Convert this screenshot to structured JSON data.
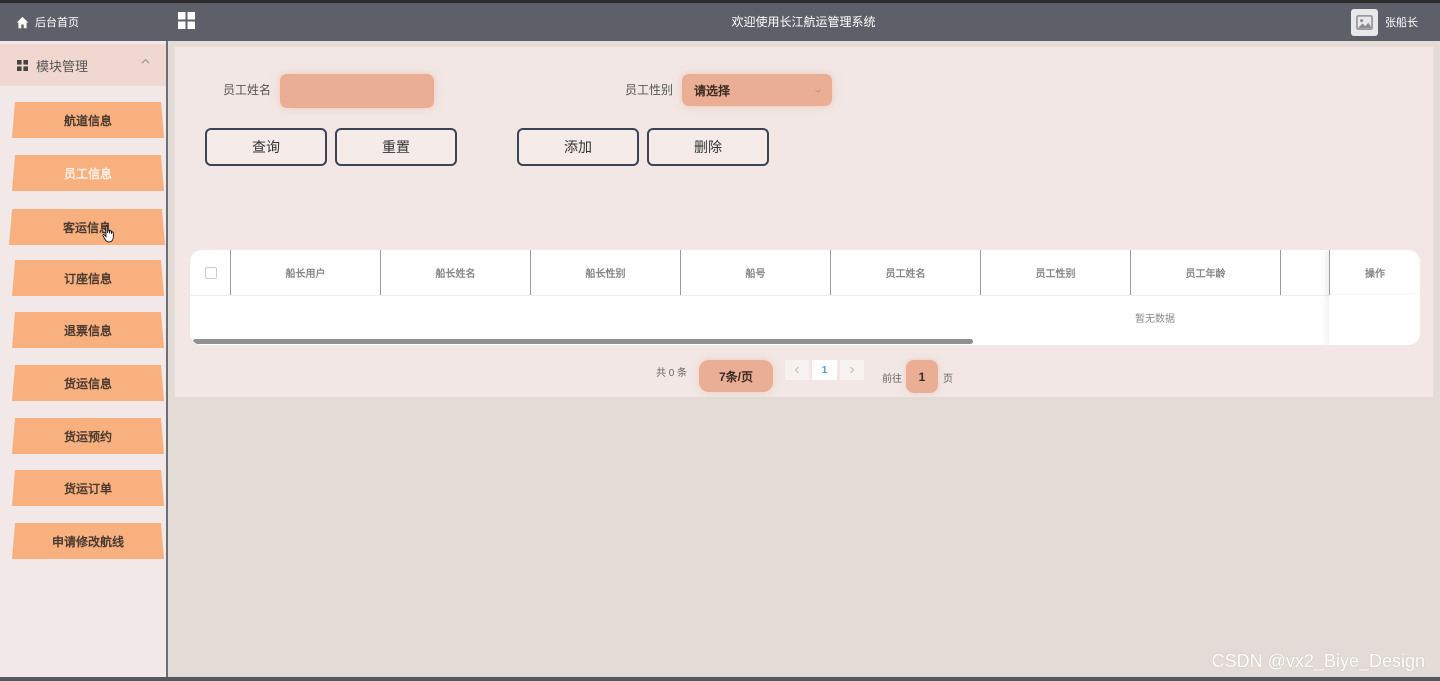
{
  "topbar": {
    "home_label": "后台首页",
    "title": "欢迎使用长江航运管理系统",
    "user_name": "张船长"
  },
  "sidebar": {
    "module_label": "模块管理",
    "items": [
      {
        "label": "航道信息"
      },
      {
        "label": "员工信息"
      },
      {
        "label": "客运信息"
      },
      {
        "label": "订座信息"
      },
      {
        "label": "退票信息"
      },
      {
        "label": "货运信息"
      },
      {
        "label": "货运预约"
      },
      {
        "label": "货运订单"
      },
      {
        "label": "申请修改航线"
      }
    ],
    "active_index": 1
  },
  "search": {
    "name_label": "员工姓名",
    "name_value": "",
    "gender_label": "员工性别",
    "gender_placeholder": "请选择"
  },
  "actions": {
    "query": "查询",
    "reset": "重置",
    "add": "添加",
    "delete": "删除"
  },
  "table": {
    "columns": [
      "船长用户",
      "船长姓名",
      "船长性别",
      "船号",
      "员工姓名",
      "员工性别",
      "员工年龄",
      "操作"
    ],
    "empty_text": "暂无数据"
  },
  "pagination": {
    "total_text": "共 0 条",
    "page_size": "7条/页",
    "current_page": "1",
    "goto_label": "前往",
    "goto_value": "1",
    "page_suffix": "页"
  },
  "watermark": "CSDN @vx2_Biye_Design",
  "colors": {
    "topbar": "#5d6068",
    "accent": "#f8b07f",
    "input_bg": "#eaae95",
    "panel_bg": "#f2e7e5",
    "pager_active": "#409eff"
  }
}
